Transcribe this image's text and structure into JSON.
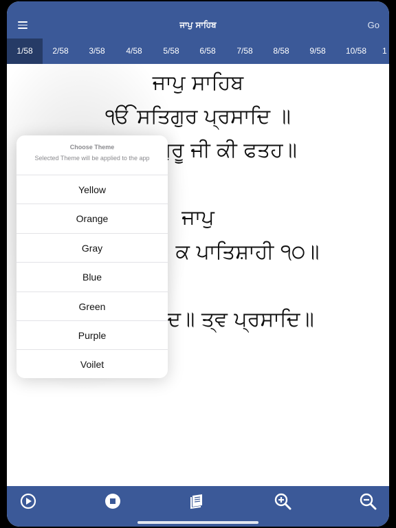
{
  "header": {
    "title": "ਜਾਪੁ ਸਾਹਿਬ",
    "go_label": "Go"
  },
  "pages": [
    "1/58",
    "2/58",
    "3/58",
    "4/58",
    "5/58",
    "6/58",
    "7/58",
    "8/58",
    "9/58",
    "10/58",
    "1"
  ],
  "active_page": "1/58",
  "content": {
    "lines": [
      "ਜਾਪੁ ਸਾਹਿਬ",
      "ੴ ਸਤਿਗੁਰ ਪ੍ਰਸਾਦਿ ॥",
      "ਗੁਰੂ ਜੀ ਕੀ ਫਤਹ॥",
      "ਜਾਪੁ",
      "ਕ ਪਾਤਿਸ਼ਾਹੀ ੧੦॥",
      "ਦ॥ ਤ੍ਵ ਪ੍ਰਸਾਦਿ॥"
    ]
  },
  "theme_popup": {
    "title": "Choose Theme",
    "subtitle": "Selected Theme will be applied to the app",
    "options": [
      "Yellow",
      "Orange",
      "Gray",
      "Blue",
      "Green",
      "Purple",
      "Voilet"
    ]
  },
  "toolbar": {
    "icons": [
      "play-icon",
      "stop-icon",
      "book-icon",
      "zoom-in-icon",
      "zoom-out-icon"
    ]
  },
  "colors": {
    "brand": "#3b5998",
    "active_tab": "#263b66",
    "text": "#111111",
    "muted": "#8a8a8e"
  }
}
